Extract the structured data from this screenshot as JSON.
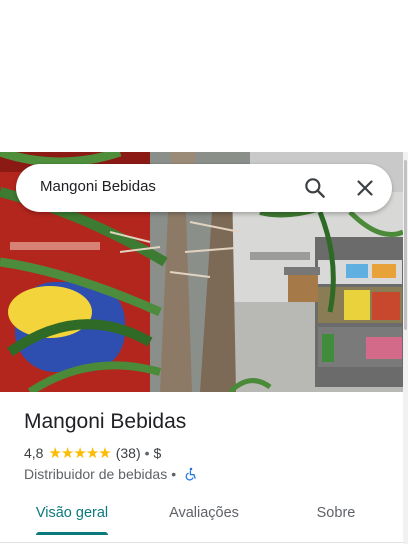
{
  "search": {
    "query": "Mangoni Bebidas"
  },
  "place": {
    "title": "Mangoni Bebidas",
    "rating": "4,8",
    "star_count": 5,
    "reviews": "(38)",
    "bullet": "•",
    "price": "$",
    "category": "Distribuidor de bebidas",
    "category_bullet": "•"
  },
  "tabs": [
    {
      "label": "Visão geral",
      "active": true
    },
    {
      "label": "Avaliações",
      "active": false
    },
    {
      "label": "Sobre",
      "active": false
    }
  ],
  "colors": {
    "accent": "#0b7a7d",
    "star": "#fbbc04"
  },
  "icons": {
    "search": "search-icon",
    "close": "close-icon",
    "accessibility": "wheelchair-icon"
  }
}
